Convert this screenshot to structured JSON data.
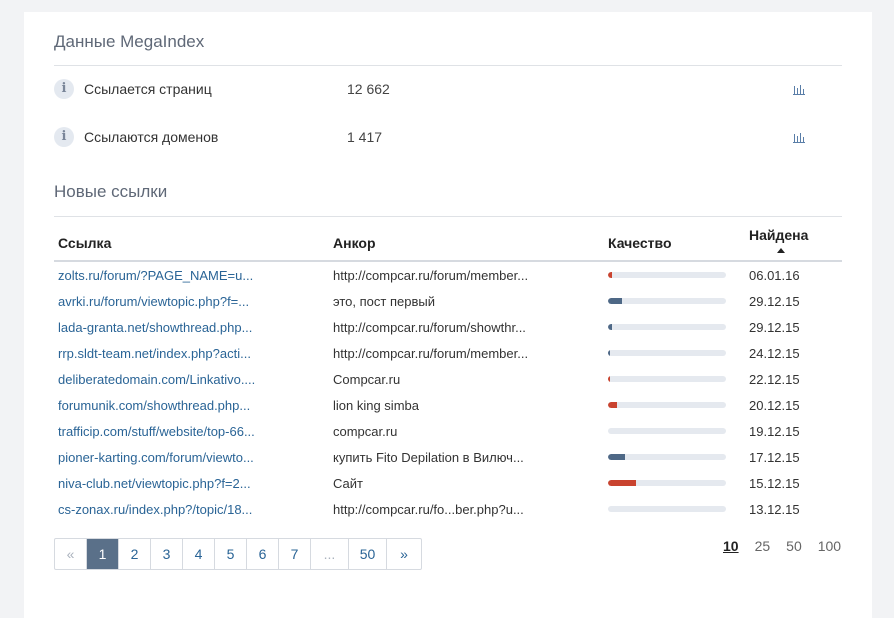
{
  "megaindex": {
    "title": "Данные MegaIndex",
    "stats": [
      {
        "label": "Ссылается страниц",
        "value": "12 662"
      },
      {
        "label": "Ссылаются доменов",
        "value": "1 417"
      }
    ]
  },
  "new_links": {
    "title": "Новые ссылки",
    "columns": {
      "link": "Ссылка",
      "anchor": "Анкор",
      "quality": "Качество",
      "found": "Найдена"
    },
    "rows": [
      {
        "link": "zolts.ru/forum/?PAGE_NAME=u...",
        "anchor": "http://compcar.ru/forum/member...",
        "quality": 0.03,
        "quality_color": "#c9432f",
        "date": "06.01.16"
      },
      {
        "link": "avrki.ru/forum/viewtopic.php?f=...",
        "anchor": "это, пост первый",
        "quality": 0.12,
        "quality_color": "#4e6886",
        "date": "29.12.15"
      },
      {
        "link": "lada-granta.net/showthread.php...",
        "anchor": "http://compcar.ru/forum/showthr...",
        "quality": 0.03,
        "quality_color": "#4e6886",
        "date": "29.12.15"
      },
      {
        "link": "rrp.sldt-team.net/index.php?acti...",
        "anchor": "http://compcar.ru/forum/member...",
        "quality": 0.01,
        "quality_color": "#4e6886",
        "date": "24.12.15"
      },
      {
        "link": "deliberatedomain.com/Linkativo....",
        "anchor": "Compcar.ru",
        "quality": 0.01,
        "quality_color": "#c9432f",
        "date": "22.12.15"
      },
      {
        "link": "forumunik.com/showthread.php...",
        "anchor": "lion king simba",
        "quality": 0.08,
        "quality_color": "#c9432f",
        "date": "20.12.15"
      },
      {
        "link": "trafficip.com/stuff/website/top-66...",
        "anchor": "compcar.ru",
        "quality": 0,
        "quality_color": "#4e6886",
        "date": "19.12.15"
      },
      {
        "link": "pioner-karting.com/forum/viewto...",
        "anchor": "купить Fito Depilation в Вилюч...",
        "quality": 0.14,
        "quality_color": "#4e6886",
        "date": "17.12.15"
      },
      {
        "link": "niva-club.net/viewtopic.php?f=2...",
        "anchor": "Сайт",
        "quality": 0.24,
        "quality_color": "#c9432f",
        "date": "15.12.15"
      },
      {
        "link": "cs-zonax.ru/index.php?/topic/18...",
        "anchor": "http://compcar.ru/fo...ber.php?u...",
        "quality": 0,
        "quality_color": "#4e6886",
        "date": "13.12.15"
      }
    ]
  },
  "pagination": {
    "items": [
      {
        "label": "«",
        "state": "muted",
        "w": 32
      },
      {
        "label": "1",
        "state": "active",
        "w": 32
      },
      {
        "label": "2",
        "state": "",
        "w": 32
      },
      {
        "label": "3",
        "state": "",
        "w": 32
      },
      {
        "label": "4",
        "state": "",
        "w": 32
      },
      {
        "label": "5",
        "state": "",
        "w": 32
      },
      {
        "label": "6",
        "state": "",
        "w": 32
      },
      {
        "label": "7",
        "state": "",
        "w": 32
      },
      {
        "label": "...",
        "state": "muted",
        "w": 38
      },
      {
        "label": "50",
        "state": "",
        "w": 38
      },
      {
        "label": "»",
        "state": "",
        "w": 34
      }
    ],
    "per_page": [
      {
        "label": "10",
        "active": true
      },
      {
        "label": "25",
        "active": false
      },
      {
        "label": "50",
        "active": false
      },
      {
        "label": "100",
        "active": false
      }
    ]
  }
}
